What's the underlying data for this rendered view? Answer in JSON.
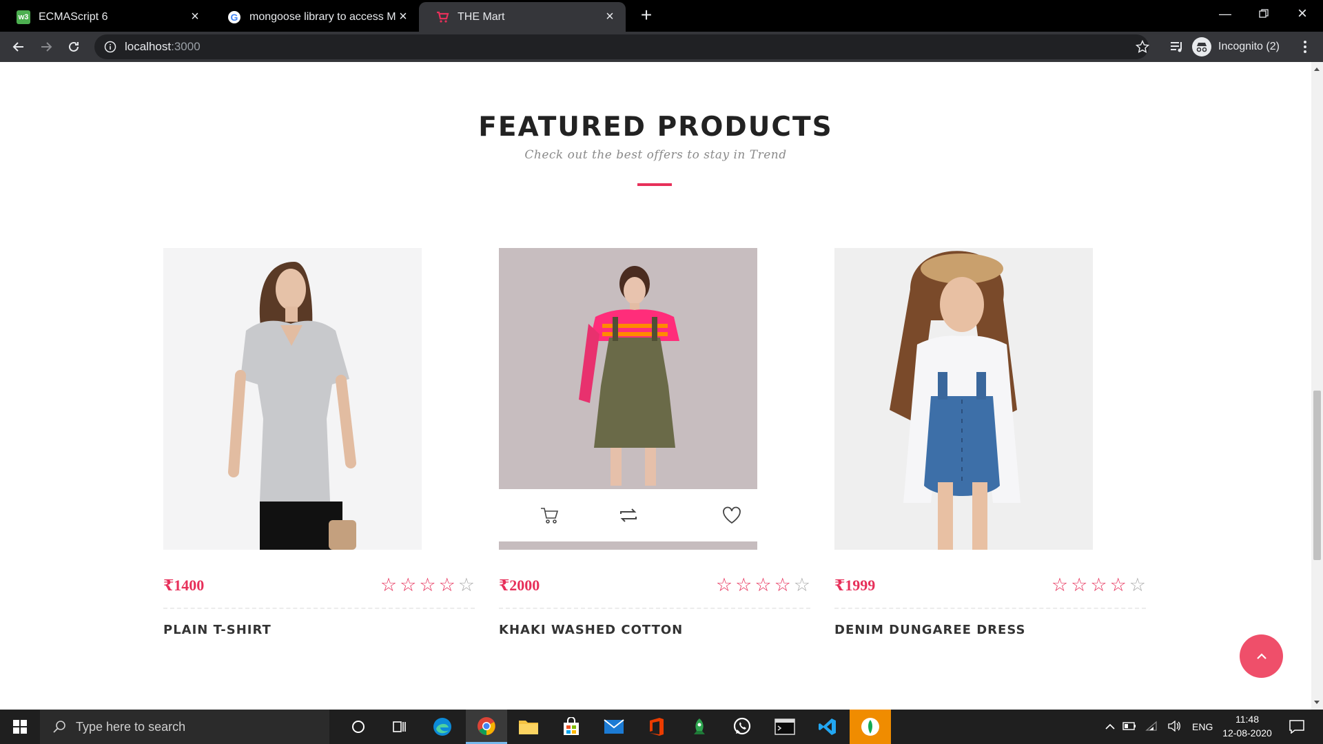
{
  "browser": {
    "tabs": [
      {
        "title": "ECMAScript 6",
        "favicon": "w3-icon"
      },
      {
        "title": "mongoose library to access Mon",
        "favicon": "google-icon"
      },
      {
        "title": "THE Mart",
        "favicon": "cart-icon",
        "active": true
      }
    ],
    "url_host": "localhost",
    "url_port": ":3000",
    "profile_label": "Incognito (2)"
  },
  "section": {
    "title": "FEATURED PRODUCTS",
    "subtitle": "Check out the best offers to stay in Trend"
  },
  "products": [
    {
      "price": "₹1400",
      "name": "PLAIN T-SHIRT",
      "rating": 4,
      "max_rating": 5
    },
    {
      "price": "₹2000",
      "name": "KHAKI WASHED COTTON",
      "rating": 4,
      "max_rating": 5
    },
    {
      "price": "₹1999",
      "name": "DENIM DUNGAREE DRESS",
      "rating": 4,
      "max_rating": 5
    }
  ],
  "taskbar": {
    "search_placeholder": "Type here to search",
    "language": "ENG",
    "time": "11:48",
    "date": "12-08-2020"
  },
  "colors": {
    "accent": "#e7305a",
    "scroll_top_button": "#ef4f6a",
    "chrome_dark": "#35363a"
  }
}
